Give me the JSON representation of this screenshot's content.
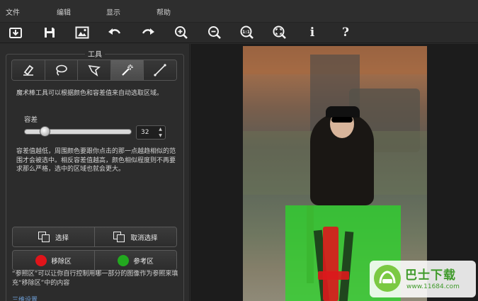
{
  "menu": [
    "文件",
    "编辑",
    "显示",
    "帮助"
  ],
  "toolbar": [
    {
      "name": "open",
      "icon": "tray-arrow-icon"
    },
    {
      "name": "save",
      "icon": "floppy-disk-icon"
    },
    {
      "name": "image",
      "icon": "picture-icon"
    },
    {
      "name": "undo",
      "icon": "undo-arrow-icon"
    },
    {
      "name": "redo",
      "icon": "redo-arrow-icon"
    },
    {
      "name": "zoom-in",
      "icon": "zoom-in-icon"
    },
    {
      "name": "zoom-out",
      "icon": "zoom-out-icon"
    },
    {
      "name": "actual-size",
      "icon": "zoom-1to1-icon",
      "label": "1:1"
    },
    {
      "name": "fit",
      "icon": "zoom-fit-icon"
    },
    {
      "name": "info",
      "icon": "info-icon",
      "label": "i"
    },
    {
      "name": "help",
      "icon": "help-icon",
      "label": "?"
    }
  ],
  "tools_panel": {
    "title": "工具",
    "tools": [
      {
        "name": "eraser",
        "icon": "eraser-icon"
      },
      {
        "name": "lasso",
        "icon": "lasso-icon"
      },
      {
        "name": "polygon-lasso",
        "icon": "polygon-lasso-icon"
      },
      {
        "name": "magic-wand",
        "icon": "magic-wand-icon",
        "active": true
      },
      {
        "name": "line",
        "icon": "line-icon"
      }
    ],
    "tool_description": "魔术棒工具可以根据颜色和容差值来自动选取区域。",
    "tolerance": {
      "label": "容差",
      "value": "32",
      "fraction": 0.16
    },
    "tolerance_help": "容差值越低，周围颜色要跟你点击的那一点越趋相似的范围才会被选中。相反容差值越高，颜色相似程度则不再要求那么严格，选中的区域也就会更大。",
    "select_label": "选择",
    "deselect_label": "取消选择",
    "remove_area_label": "移除区",
    "reference_area_label": "参考区",
    "remove_color": "#e0141a",
    "reference_color": "#22a81f",
    "reference_note": "“参照区”可以让你自行控制用哪一部分的图像作为参照来填充“移除区”中的内容",
    "link_text": "三维设置"
  },
  "watermark": {
    "title": "巴士下载",
    "url": "www.11684.com"
  }
}
